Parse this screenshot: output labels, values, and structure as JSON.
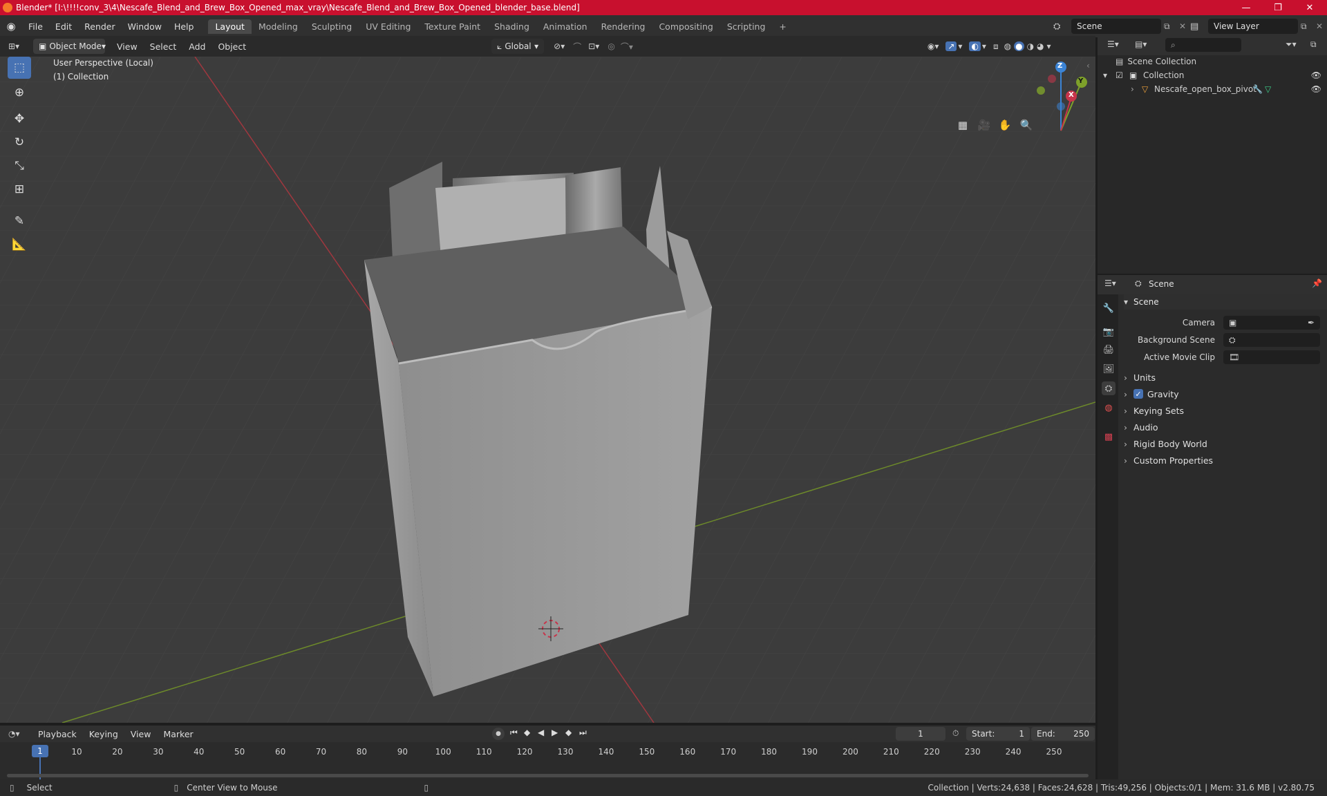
{
  "window": {
    "title": "Blender* [I:\\!!!!conv_3\\4\\Nescafe_Blend_and_Brew_Box_Opened_max_vray\\Nescafe_Blend_and_Brew_Box_Opened_blender_base.blend]",
    "minimize": "—",
    "maximize": "❐",
    "close": "✕"
  },
  "menu": {
    "items": [
      "File",
      "Edit",
      "Render",
      "Window",
      "Help"
    ],
    "workspaces": [
      "Layout",
      "Modeling",
      "Sculpting",
      "UV Editing",
      "Texture Paint",
      "Shading",
      "Animation",
      "Rendering",
      "Compositing",
      "Scripting"
    ],
    "add_workspace": "+",
    "scene_label": "Scene",
    "view_layer_label": "View Layer"
  },
  "viewport_header": {
    "mode": "Object Mode",
    "menus": [
      "View",
      "Select",
      "Add",
      "Object"
    ],
    "orientation": "Global"
  },
  "viewport": {
    "perspective_label": "User Perspective (Local)",
    "collection_label": "(1) Collection",
    "gizmo": {
      "z": "Z",
      "y": "Y",
      "x": "X"
    }
  },
  "outliner": {
    "root": "Scene Collection",
    "collection": "Collection",
    "object": "Nescafe_open_box_pivot"
  },
  "properties": {
    "tab_title": "Scene",
    "section": "Scene",
    "fields": [
      {
        "label": "Camera",
        "value": ""
      },
      {
        "label": "Background Scene",
        "value": ""
      },
      {
        "label": "Active Movie Clip",
        "value": ""
      }
    ],
    "panels": [
      "Units",
      "Gravity",
      "Keying Sets",
      "Audio",
      "Rigid Body World",
      "Custom Properties"
    ],
    "gravity_checked": true
  },
  "timeline": {
    "menus": [
      "Playback",
      "Keying",
      "View",
      "Marker"
    ],
    "current_frame": "1",
    "start_label": "Start:",
    "start_value": "1",
    "end_label": "End:",
    "end_value": "250",
    "ticks": [
      "1",
      "10",
      "20",
      "30",
      "40",
      "50",
      "60",
      "70",
      "80",
      "90",
      "100",
      "110",
      "120",
      "130",
      "140",
      "150",
      "160",
      "170",
      "180",
      "190",
      "200",
      "210",
      "220",
      "230",
      "240",
      "250"
    ]
  },
  "statusbar": {
    "select": "Select",
    "center_view": "Center View to Mouse",
    "stats": "Collection | Verts:24,638 | Faces:24,628 | Tris:49,256 | Objects:0/1 | Mem: 31.6 MB | v2.80.75"
  },
  "colors": {
    "title_bar": "#c8102e",
    "active_tool": "#4772b3",
    "axis_x": "#c8344a",
    "axis_y": "#7ea12a",
    "axis_z": "#3b84d6"
  }
}
